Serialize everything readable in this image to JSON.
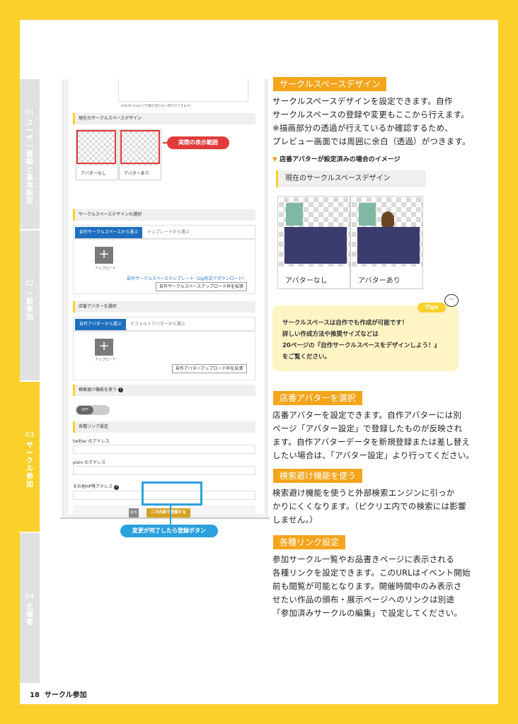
{
  "side_tabs": [
    {
      "num": "01",
      "label": "ユーザー登録と基本設定",
      "active": false
    },
    {
      "num": "02",
      "label": "一般参加",
      "active": false
    },
    {
      "num": "03",
      "label": "サークル参加",
      "active": true
    },
    {
      "num": "04",
      "label": "主催者",
      "active": false
    }
  ],
  "screenshot": {
    "hint": "※Shift+Enterで行間の空かない改行ができます。",
    "current_design_heading": "現在のサークルスペースデザイン",
    "thumb_no_avatar": "アバターなし",
    "thumb_with_avatar": "アバターあり",
    "select_heading": "サークルスペースデザインの選択",
    "tab_custom": "自作サークルスペースから選ぶ",
    "tab_template": "テンプレートから選ぶ",
    "upload_label": "アップロード",
    "template_link": "自作サークルスペーステンプレート（zip形式でダウンロード）",
    "expand_space_btn": "自作サークルスペースアップロード枠を拡張",
    "avatar_heading": "店番アバターを選択",
    "tab_custom_avatar": "自作アバターから選ぶ",
    "tab_default_avatar": "デフォルトアバターから選ぶ",
    "expand_avatar_btn": "自作アバターアップロード枠を拡張",
    "search_heading": "検索避け機能を使う",
    "toggle": "OFF",
    "links_heading": "各種リンク設定",
    "twitter_label": "twitter のアドレス",
    "pixiv_label": "pixiv のアドレス",
    "hp_label": "その他HP等アドレス",
    "back_btn": "戻る",
    "register_btn": "この内容で登録する"
  },
  "callouts": {
    "display_area": "実際の表示範囲",
    "register_button": "変更が完了したら登録ボタン"
  },
  "section1": {
    "title": "サークルスペースデザイン",
    "lines": [
      "サークルスペースデザインを設定できます。自作",
      "サークルスペースの登録や変更もここから行えます。",
      "※描画部分の透過が行えているか確認するため、",
      "プレビュー画面では周囲に余白（透過）がつきます。"
    ],
    "image_caption": "店番アバターが設定済みの場合のイメージ",
    "preview_heading": "現在のサークルスペースデザイン",
    "preview_no_avatar": "アバターなし",
    "preview_with_avatar": "アバターあり"
  },
  "tips": {
    "label": "Tips",
    "lines": [
      "サークルスペースは自作でも作成が可能です！",
      "詳しい作成方法や推奨サイズなどは",
      "20ページの『自作サークルスペースをデザインしよう！』",
      "をご覧ください。"
    ]
  },
  "section2": {
    "title": "店番アバターを選択",
    "lines": [
      "店番アバターを設定できます。自作アバターには別",
      "ページ「アバター設定」で登録したものが反映され",
      "ます。自作アバターデータを新規登録または差し替え",
      "したい場合は、「アバター設定」より行ってください。"
    ]
  },
  "section3": {
    "title": "検索避け機能を使う",
    "lines": [
      "検索避け機能を使うと外部検索エンジンに引っか",
      "かりにくくなります。（ピクリエ内での検索には影響",
      "しません。）"
    ]
  },
  "section4": {
    "title": "各種リンク設定",
    "lines": [
      "参加サークル一覧やお品書きページに表示される",
      "各種リンクを設定できます。このURLはイベント開始",
      "前も閲覧が可能となります。開催時間中のみ表示さ",
      "せたい作品の頒布・展示ページへのリンクは別途",
      "「参加済みサークルの編集」で設定してください。"
    ]
  },
  "footer": {
    "page": "18",
    "label": "サークル参加"
  },
  "colors": {
    "frame": "#fbd02a",
    "header": "#f5a51b",
    "blue": "#1f6fbf",
    "red": "#e23a3a",
    "callout_blue": "#2aa0dc"
  }
}
